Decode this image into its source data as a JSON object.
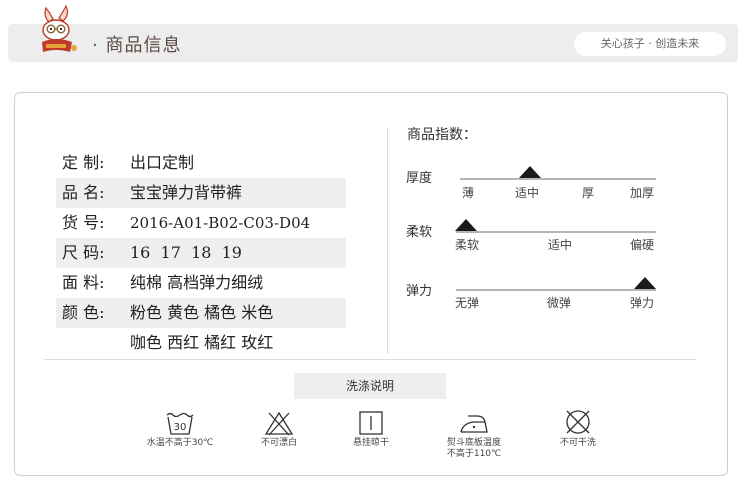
{
  "header": {
    "title": "· 商品信息",
    "slogan": "关心孩子 · 创造未来"
  },
  "specs": [
    {
      "label": "定 制:",
      "value": "出口定制"
    },
    {
      "label": "品 名:",
      "value": "宝宝弹力背带裤"
    },
    {
      "label": "货 号:",
      "value": "2016-A01-B02-C03-D04"
    },
    {
      "label": "尺 码:",
      "value": "16  17  18  19"
    },
    {
      "label": "面 料:",
      "value": "纯棉 高档弹力细绒"
    },
    {
      "label": "颜 色:",
      "value": "粉色 黄色 橘色 米色"
    },
    {
      "label": "",
      "value": "咖色 西红 橘红 玫红"
    }
  ],
  "index": {
    "title": "商品指数：",
    "scales": [
      {
        "name": "厚度",
        "ticks": [
          "薄",
          "适中",
          "厚",
          "加厚"
        ],
        "selected": "适中"
      },
      {
        "name": "柔软",
        "ticks": [
          "柔软",
          "适中",
          "偏硬"
        ],
        "selected": "柔软"
      },
      {
        "name": "弹力",
        "ticks": [
          "无弹",
          "微弹",
          "弹力"
        ],
        "selected": "弹力"
      }
    ]
  },
  "care": {
    "title": "洗涤说明",
    "items": [
      {
        "icon": "wash-30-icon",
        "temp": "30",
        "text": "水温不高于30℃"
      },
      {
        "icon": "no-bleach-icon",
        "text": "不可漂白"
      },
      {
        "icon": "hang-dry-icon",
        "text": "悬挂晾干"
      },
      {
        "icon": "iron-icon",
        "text": "熨斗底板温度",
        "text2": "不高于110℃"
      },
      {
        "icon": "no-dry-clean-icon",
        "text": "不可干洗"
      }
    ]
  },
  "colors": {
    "marker": "#1a1a1a",
    "header_bg": "#ededed",
    "shade": "#efefef",
    "mascot_red": "#c0392b",
    "mascot_accent": "#e8a33d"
  }
}
